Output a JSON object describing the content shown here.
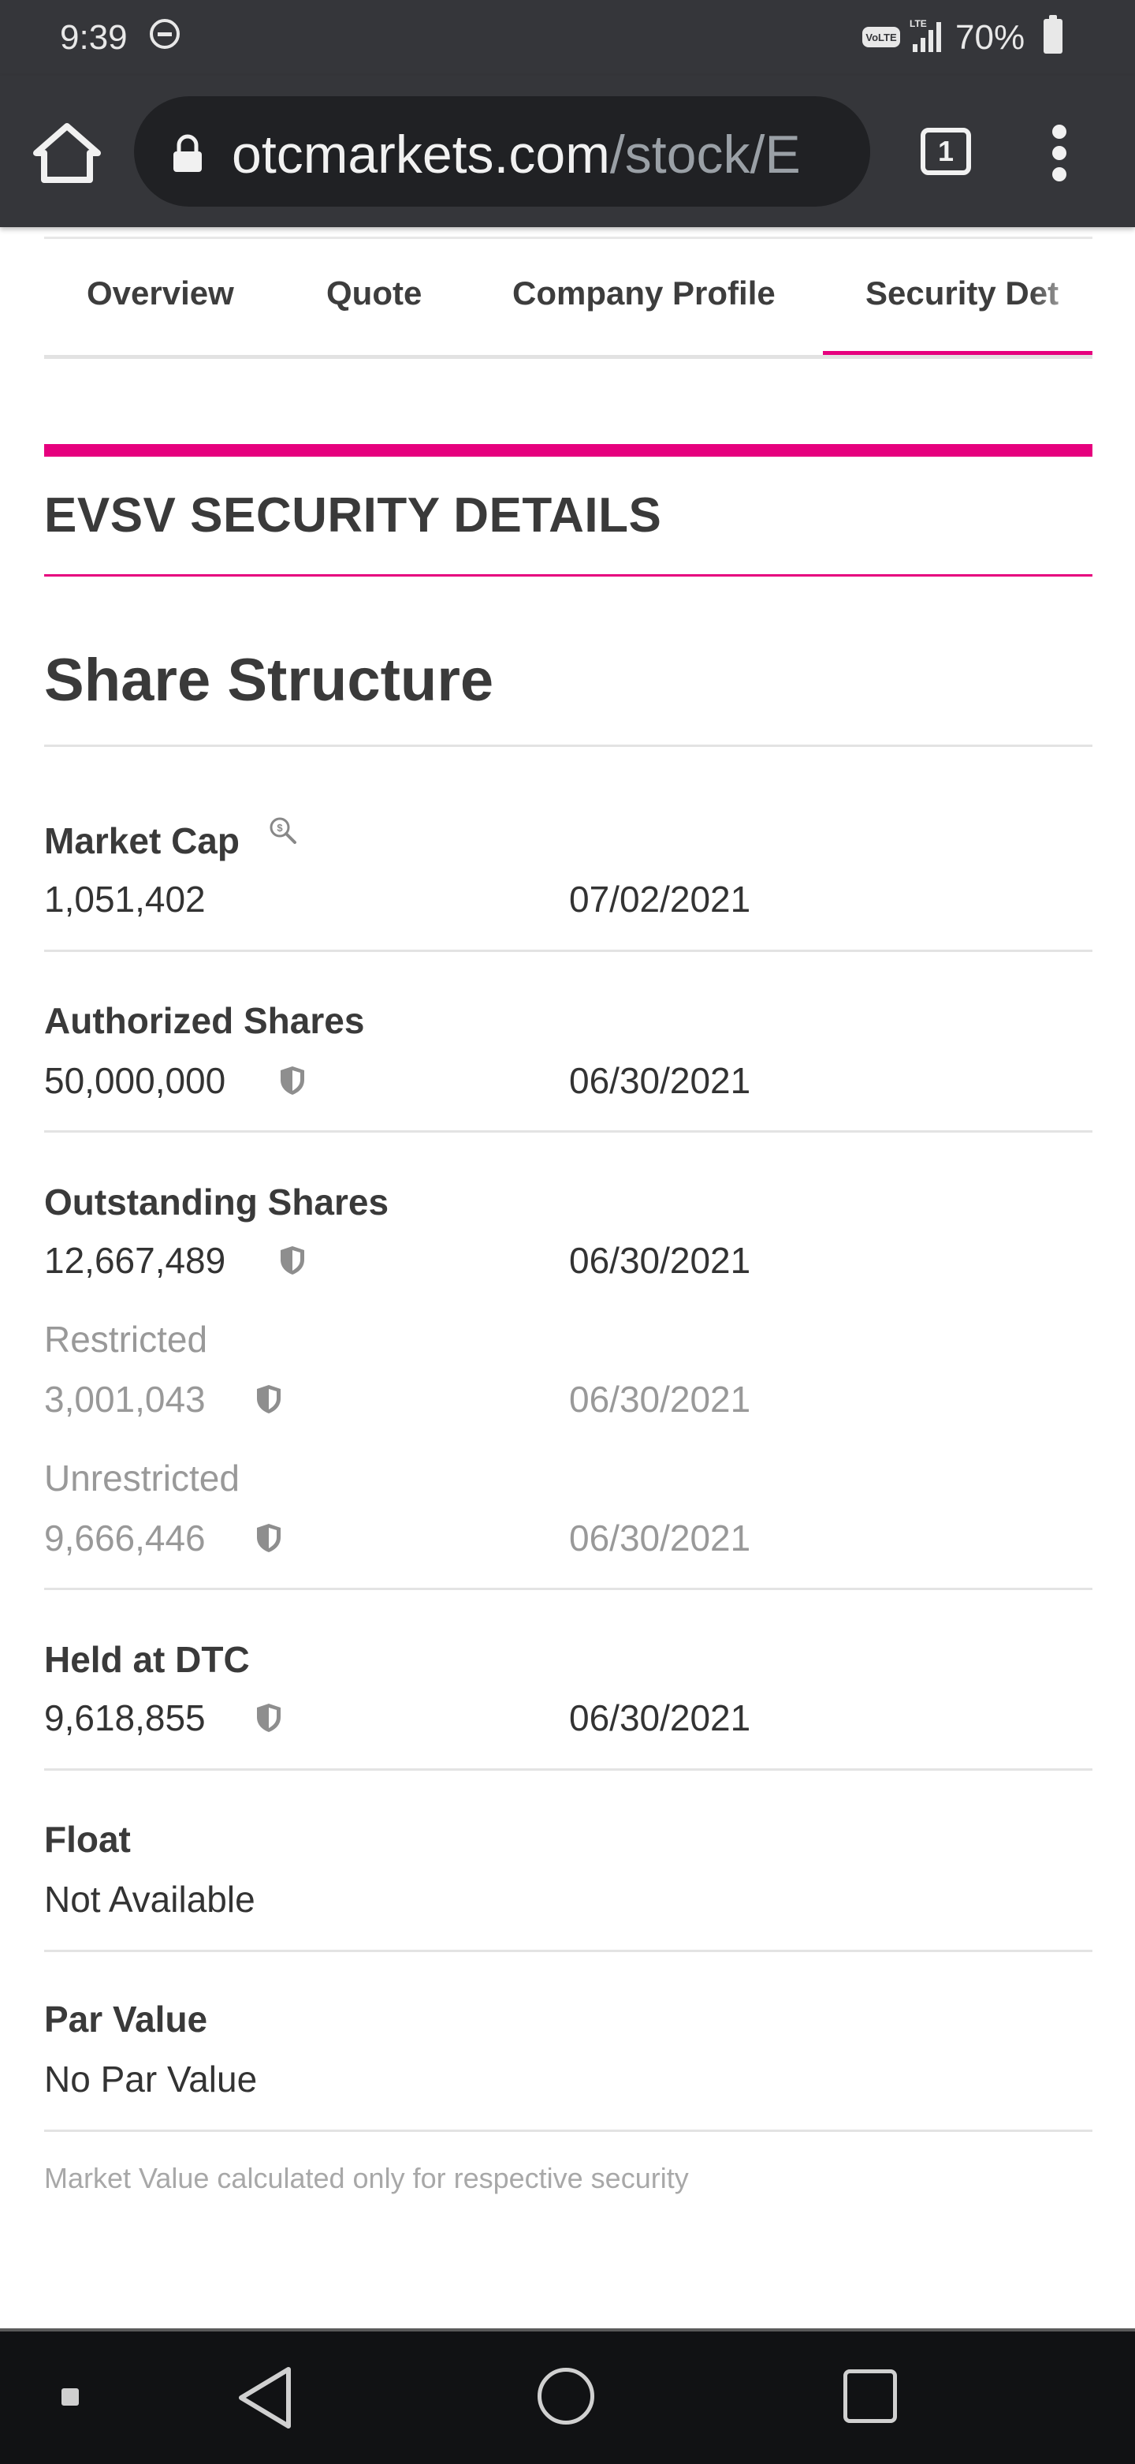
{
  "status_bar": {
    "time": "9:39",
    "battery": "70%",
    "icons": [
      "do-not-disturb-icon",
      "volte-icon",
      "lte-signal-icon",
      "battery-icon"
    ]
  },
  "browser": {
    "url_host": "otcmarkets.com",
    "url_path": "/stock/E",
    "tab_count": "1",
    "icons": [
      "home-icon",
      "lock-icon",
      "tab-switcher-icon",
      "more-options-icon"
    ]
  },
  "tabs": [
    {
      "label": "Overview"
    },
    {
      "label": "Quote"
    },
    {
      "label": "Company Profile"
    },
    {
      "label": "Security Det",
      "active": true
    }
  ],
  "section_title": "EVSV SECURITY DETAILS",
  "share_structure": {
    "heading": "Share Structure",
    "market_cap": {
      "label": "Market Cap",
      "value": "1,051,402",
      "date": "07/02/2021"
    },
    "authorized": {
      "label": "Authorized Shares",
      "value": "50,000,000",
      "date": "06/30/2021"
    },
    "outstanding": {
      "label": "Outstanding Shares",
      "value": "12,667,489",
      "date": "06/30/2021"
    },
    "restricted": {
      "label": "Restricted",
      "value": "3,001,043",
      "date": "06/30/2021"
    },
    "unrestricted": {
      "label": "Unrestricted",
      "value": "9,666,446",
      "date": "06/30/2021"
    },
    "held_dtc": {
      "label": "Held at DTC",
      "value": "9,618,855",
      "date": "06/30/2021"
    },
    "float": {
      "label": "Float",
      "value": "Not Available"
    },
    "par_value": {
      "label": "Par Value",
      "value": "No Par Value"
    }
  },
  "footnote": "Market Value calculated only for respective security",
  "colors": {
    "accent": "#e6007e",
    "toolbar": "#35363a"
  }
}
